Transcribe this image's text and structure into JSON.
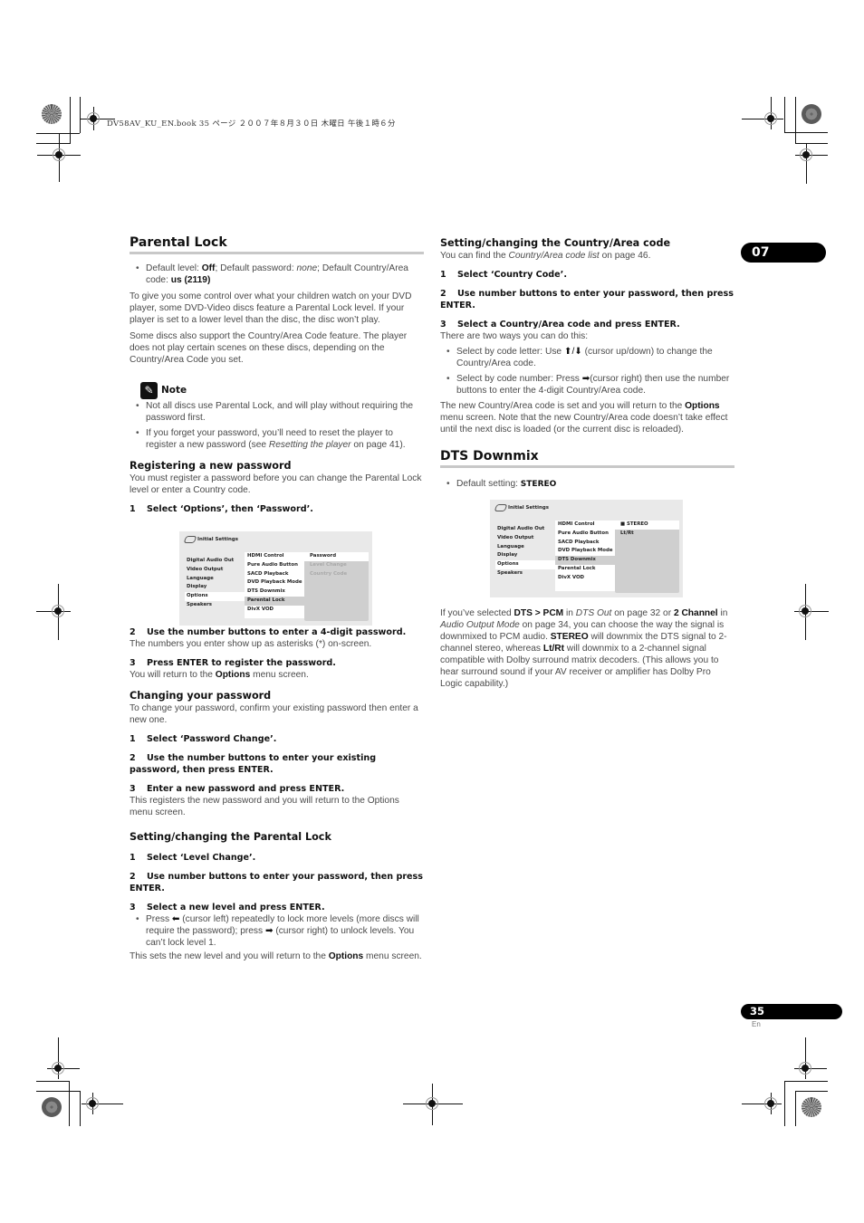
{
  "header": {
    "print_slug": "DV58AV_KU_EN.book  35 ページ  ２００７年８月３０日  木曜日  午後１時６分"
  },
  "chapter_tab": "07",
  "page_number": "35",
  "page_lang": "En",
  "left": {
    "title": "Parental Lock",
    "defaults": {
      "level_label": "Default level: ",
      "level_value": "Off",
      "password_label": "; Default password: ",
      "password_value": "none",
      "country_label": "; Default Country/Area code: ",
      "country_value": "us (2119)"
    },
    "intro_1": "To give you some control over what your children watch on your DVD player, some DVD-Video discs feature a Parental Lock level. If your player is set to a lower level than the disc, the disc won’t play.",
    "intro_2": "Some discs also support the Country/Area Code feature. The player does not play certain scenes on these discs, depending on the Country/Area Code you set.",
    "note": {
      "label": "Note",
      "items": [
        "Not all discs use Parental Lock, and will play without requiring the password first.",
        {
          "pre": "If you forget your password, you’ll need to reset the player to register a new password (see ",
          "italic": "Resetting the player",
          "post": " on page 41)."
        }
      ]
    },
    "register": {
      "title": "Registering a new password",
      "intro": "You must register a password before you can change the Parental Lock level or enter a Country code.",
      "step1": {
        "n": "1",
        "text": "Select ‘Options’, then ‘Password’."
      },
      "step2": {
        "n": "2",
        "text": "Use the number buttons to enter a 4-digit password.",
        "desc": "The numbers you enter show up as asterisks (*) on-screen."
      },
      "step3": {
        "n": "3",
        "text": "Press ENTER to register the password.",
        "desc_pre": "You will return to the ",
        "desc_bold": "Options",
        "desc_post": " menu screen."
      }
    },
    "change": {
      "title": "Changing your password",
      "intro": "To change your password, confirm your existing password then enter a new one.",
      "step1": {
        "n": "1",
        "text": "Select ‘Password Change’."
      },
      "step2": {
        "n": "2",
        "text": "Use the number buttons to enter your existing password, then press ENTER."
      },
      "step3": {
        "n": "3",
        "text": "Enter a new password and press ENTER.",
        "desc": "This registers the new password and you will return to the Options menu screen."
      }
    },
    "setlock": {
      "title": "Setting/changing the Parental Lock",
      "step1": {
        "n": "1",
        "text": "Select ‘Level Change’."
      },
      "step2": {
        "n": "2",
        "text": "Use number buttons to enter your password, then press ENTER."
      },
      "step3": {
        "n": "3",
        "text": "Select a new level and press ENTER."
      },
      "bullet": {
        "pre": "Press ",
        "arrow_left": "⬅",
        "mid": " (cursor left) repeatedly to lock more levels (more discs will require the password); press ",
        "arrow_right": "➡",
        "post": " (cursor right) to unlock levels. You can’t lock level 1."
      },
      "outro_pre": "This sets the new level and you will return to the ",
      "outro_bold": "Options",
      "outro_post": " menu screen."
    }
  },
  "osd1": {
    "title": "Initial Settings",
    "col1": [
      "Digital Audio Out",
      "Video Output",
      "Language",
      "Display",
      "Options",
      "Speakers"
    ],
    "col1_selected": "Options",
    "col2": [
      "HDMI Control",
      "Pure Audio Button",
      "SACD Playback",
      "DVD Playback Mode",
      "DTS Downmix",
      "Parental Lock",
      "DivX VOD"
    ],
    "col2_selected": "Parental Lock",
    "col3": [
      "Password",
      "Level Change",
      "Country Code"
    ],
    "col3_selected": "Password"
  },
  "right": {
    "country": {
      "title": "Setting/changing the Country/Area code",
      "intro_pre": "You can find the ",
      "intro_italic": "Country/Area code list",
      "intro_post": " on page 46.",
      "step1": {
        "n": "1",
        "text": "Select ‘Country Code’."
      },
      "step2": {
        "n": "2",
        "text": "Use number buttons to enter your password, then press ENTER."
      },
      "step3": {
        "n": "3",
        "text": "Select a Country/Area code and press ENTER.",
        "desc": "There are two ways you can do this:"
      },
      "bullet1": {
        "pre": "Select by code letter: Use ",
        "arrows": "⬆/⬇",
        "post": " (cursor up/down) to change the Country/Area code."
      },
      "bullet2": {
        "pre": "Select by code number: Press ",
        "arrow": "➡",
        "post": "(cursor right) then use the number buttons to enter the 4-digit Country/Area code."
      },
      "outro_pre": "The new Country/Area code is set and you will return to the ",
      "outro_bold": "Options",
      "outro_post": " menu screen. Note that the new Country/Area code doesn’t take effect until the next disc is loaded (or the current disc is reloaded)."
    },
    "dts": {
      "title": "DTS Downmix",
      "default_label": "Default setting: ",
      "default_value": "STEREO",
      "body": [
        {
          "t": "If you’ve selected "
        },
        {
          "b": "DTS > PCM"
        },
        {
          "t": " in "
        },
        {
          "i": "DTS Out"
        },
        {
          "t": " on page 32 or "
        },
        {
          "b": "2 Channel"
        },
        {
          "t": " in "
        },
        {
          "i": "Audio Output Mode"
        },
        {
          "t": " on page 34, you can choose the way the signal is downmixed to PCM audio. "
        },
        {
          "b": "STEREO"
        },
        {
          "t": " will downmix the DTS signal to 2-channel stereo, whereas "
        },
        {
          "b": "Lt/Rt"
        },
        {
          "t": " will downmix to a 2-channel signal compatible with Dolby surround matrix decoders. (This allows you to hear surround sound if your AV receiver or amplifier has Dolby Pro Logic capability.)"
        }
      ]
    }
  },
  "osd2": {
    "title": "Initial Settings",
    "col1": [
      "Digital Audio Out",
      "Video Output",
      "Language",
      "Display",
      "Options",
      "Speakers"
    ],
    "col1_selected": "Options",
    "col2": [
      "HDMI Control",
      "Pure Audio Button",
      "SACD Playback",
      "DVD Playback Mode",
      "DTS Downmix",
      "Parental Lock",
      "DivX VOD"
    ],
    "col2_selected": "DTS Downmix",
    "col3": [
      "■ STEREO",
      "Lt/Rt"
    ],
    "col3_selected": "■ STEREO"
  }
}
